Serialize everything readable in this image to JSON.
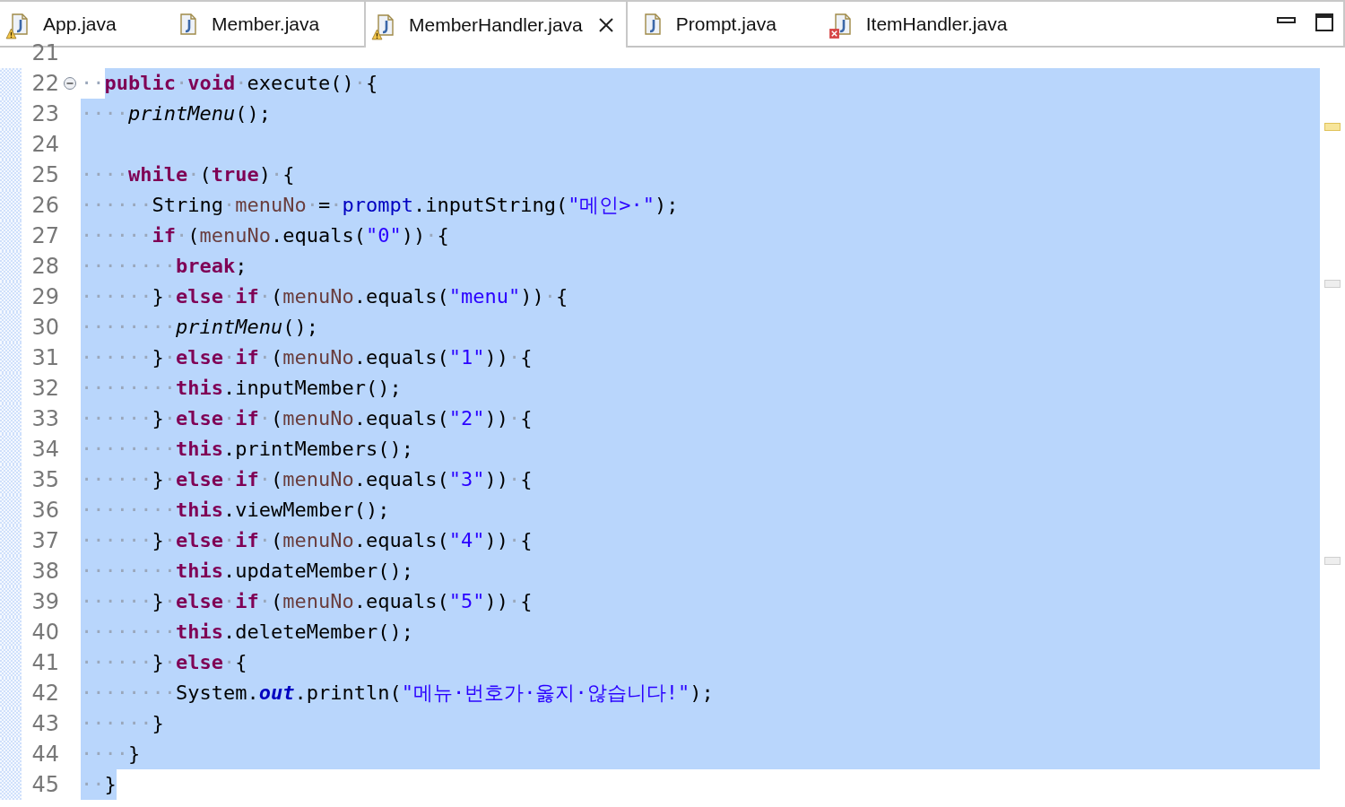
{
  "tabs": [
    {
      "label": "App.java",
      "selected": false,
      "warning": true
    },
    {
      "label": "Member.java",
      "selected": false
    },
    {
      "label": "MemberHandler.java",
      "selected": true,
      "warning": true
    },
    {
      "label": "Prompt.java",
      "selected": false
    },
    {
      "label": "ItemHandler.java",
      "selected": false,
      "error": true
    }
  ],
  "lines": [
    {
      "number": "21",
      "selected": false
    },
    {
      "number": "22",
      "expanded": true,
      "selected": true,
      "indent_unselected": true,
      "fill_to_edge": true,
      "tokens": [
        {
          "kind": "ws",
          "t": "··"
        },
        {
          "kind": "kw",
          "t": "public"
        },
        {
          "kind": "ws",
          "t": "·"
        },
        {
          "kind": "kw",
          "t": "void"
        },
        {
          "kind": "ws",
          "t": "·"
        },
        {
          "kind": "pl",
          "t": "execute()"
        },
        {
          "kind": "ws",
          "t": "·"
        },
        {
          "kind": "pl",
          "t": "{"
        }
      ]
    },
    {
      "number": "23",
      "selected": true,
      "fill_to_edge": true,
      "tokens": [
        {
          "kind": "ws",
          "t": "····"
        },
        {
          "kind": "it",
          "t": "printMenu"
        },
        {
          "kind": "pl",
          "t": "();"
        }
      ]
    },
    {
      "number": "24",
      "selected": true,
      "fill_to_edge": true
    },
    {
      "number": "25",
      "selected": true,
      "fill_to_edge": true,
      "tokens": [
        {
          "kind": "ws",
          "t": "····"
        },
        {
          "kind": "kw",
          "t": "while"
        },
        {
          "kind": "ws",
          "t": "·"
        },
        {
          "kind": "pl",
          "t": "("
        },
        {
          "kind": "kw",
          "t": "true"
        },
        {
          "kind": "pl",
          "t": ")"
        },
        {
          "kind": "ws",
          "t": "·"
        },
        {
          "kind": "pl",
          "t": "{"
        }
      ]
    },
    {
      "number": "26",
      "selected": true,
      "fill_to_edge": true,
      "tokens": [
        {
          "kind": "ws",
          "t": "······"
        },
        {
          "kind": "pl",
          "t": "String"
        },
        {
          "kind": "ws",
          "t": "·"
        },
        {
          "kind": "var",
          "t": "menuNo"
        },
        {
          "kind": "ws",
          "t": "·"
        },
        {
          "kind": "pl",
          "t": "="
        },
        {
          "kind": "ws",
          "t": "·"
        },
        {
          "kind": "fld",
          "t": "prompt"
        },
        {
          "kind": "pl",
          "t": ".inputString("
        },
        {
          "kind": "str",
          "t": "\"메인>·\""
        },
        {
          "kind": "pl",
          "t": ");"
        }
      ]
    },
    {
      "number": "27",
      "selected": true,
      "fill_to_edge": true,
      "tokens": [
        {
          "kind": "ws",
          "t": "······"
        },
        {
          "kind": "kw",
          "t": "if"
        },
        {
          "kind": "ws",
          "t": "·"
        },
        {
          "kind": "pl",
          "t": "("
        },
        {
          "kind": "var",
          "t": "menuNo"
        },
        {
          "kind": "pl",
          "t": ".equals("
        },
        {
          "kind": "str",
          "t": "\"0\""
        },
        {
          "kind": "pl",
          "t": "))"
        },
        {
          "kind": "ws",
          "t": "·"
        },
        {
          "kind": "pl",
          "t": "{"
        }
      ]
    },
    {
      "number": "28",
      "selected": true,
      "fill_to_edge": true,
      "tokens": [
        {
          "kind": "ws",
          "t": "········"
        },
        {
          "kind": "kw",
          "t": "break"
        },
        {
          "kind": "pl",
          "t": ";"
        }
      ]
    },
    {
      "number": "29",
      "selected": true,
      "fill_to_edge": true,
      "tokens": [
        {
          "kind": "ws",
          "t": "······"
        },
        {
          "kind": "pl",
          "t": "}"
        },
        {
          "kind": "ws",
          "t": "·"
        },
        {
          "kind": "kw",
          "t": "else"
        },
        {
          "kind": "ws",
          "t": "·"
        },
        {
          "kind": "kw",
          "t": "if"
        },
        {
          "kind": "ws",
          "t": "·"
        },
        {
          "kind": "pl",
          "t": "("
        },
        {
          "kind": "var",
          "t": "menuNo"
        },
        {
          "kind": "pl",
          "t": ".equals("
        },
        {
          "kind": "str",
          "t": "\"menu\""
        },
        {
          "kind": "pl",
          "t": "))"
        },
        {
          "kind": "ws",
          "t": "·"
        },
        {
          "kind": "pl",
          "t": "{"
        }
      ]
    },
    {
      "number": "30",
      "selected": true,
      "fill_to_edge": true,
      "tokens": [
        {
          "kind": "ws",
          "t": "········"
        },
        {
          "kind": "it",
          "t": "printMenu"
        },
        {
          "kind": "pl",
          "t": "();"
        }
      ]
    },
    {
      "number": "31",
      "selected": true,
      "fill_to_edge": true,
      "tokens": [
        {
          "kind": "ws",
          "t": "······"
        },
        {
          "kind": "pl",
          "t": "}"
        },
        {
          "kind": "ws",
          "t": "·"
        },
        {
          "kind": "kw",
          "t": "else"
        },
        {
          "kind": "ws",
          "t": "·"
        },
        {
          "kind": "kw",
          "t": "if"
        },
        {
          "kind": "ws",
          "t": "·"
        },
        {
          "kind": "pl",
          "t": "("
        },
        {
          "kind": "var",
          "t": "menuNo"
        },
        {
          "kind": "pl",
          "t": ".equals("
        },
        {
          "kind": "str",
          "t": "\"1\""
        },
        {
          "kind": "pl",
          "t": "))"
        },
        {
          "kind": "ws",
          "t": "·"
        },
        {
          "kind": "pl",
          "t": "{"
        }
      ]
    },
    {
      "number": "32",
      "selected": true,
      "fill_to_edge": true,
      "tokens": [
        {
          "kind": "ws",
          "t": "········"
        },
        {
          "kind": "kw",
          "t": "this"
        },
        {
          "kind": "pl",
          "t": ".inputMember();"
        }
      ]
    },
    {
      "number": "33",
      "selected": true,
      "fill_to_edge": true,
      "tokens": [
        {
          "kind": "ws",
          "t": "······"
        },
        {
          "kind": "pl",
          "t": "}"
        },
        {
          "kind": "ws",
          "t": "·"
        },
        {
          "kind": "kw",
          "t": "else"
        },
        {
          "kind": "ws",
          "t": "·"
        },
        {
          "kind": "kw",
          "t": "if"
        },
        {
          "kind": "ws",
          "t": "·"
        },
        {
          "kind": "pl",
          "t": "("
        },
        {
          "kind": "var",
          "t": "menuNo"
        },
        {
          "kind": "pl",
          "t": ".equals("
        },
        {
          "kind": "str",
          "t": "\"2\""
        },
        {
          "kind": "pl",
          "t": "))"
        },
        {
          "kind": "ws",
          "t": "·"
        },
        {
          "kind": "pl",
          "t": "{"
        }
      ]
    },
    {
      "number": "34",
      "selected": true,
      "fill_to_edge": true,
      "tokens": [
        {
          "kind": "ws",
          "t": "········"
        },
        {
          "kind": "kw",
          "t": "this"
        },
        {
          "kind": "pl",
          "t": ".printMembers();"
        }
      ]
    },
    {
      "number": "35",
      "selected": true,
      "fill_to_edge": true,
      "tokens": [
        {
          "kind": "ws",
          "t": "······"
        },
        {
          "kind": "pl",
          "t": "}"
        },
        {
          "kind": "ws",
          "t": "·"
        },
        {
          "kind": "kw",
          "t": "else"
        },
        {
          "kind": "ws",
          "t": "·"
        },
        {
          "kind": "kw",
          "t": "if"
        },
        {
          "kind": "ws",
          "t": "·"
        },
        {
          "kind": "pl",
          "t": "("
        },
        {
          "kind": "var",
          "t": "menuNo"
        },
        {
          "kind": "pl",
          "t": ".equals("
        },
        {
          "kind": "str",
          "t": "\"3\""
        },
        {
          "kind": "pl",
          "t": "))"
        },
        {
          "kind": "ws",
          "t": "·"
        },
        {
          "kind": "pl",
          "t": "{"
        }
      ]
    },
    {
      "number": "36",
      "selected": true,
      "fill_to_edge": true,
      "tokens": [
        {
          "kind": "ws",
          "t": "········"
        },
        {
          "kind": "kw",
          "t": "this"
        },
        {
          "kind": "pl",
          "t": ".viewMember();"
        }
      ]
    },
    {
      "number": "37",
      "selected": true,
      "fill_to_edge": true,
      "tokens": [
        {
          "kind": "ws",
          "t": "······"
        },
        {
          "kind": "pl",
          "t": "}"
        },
        {
          "kind": "ws",
          "t": "·"
        },
        {
          "kind": "kw",
          "t": "else"
        },
        {
          "kind": "ws",
          "t": "·"
        },
        {
          "kind": "kw",
          "t": "if"
        },
        {
          "kind": "ws",
          "t": "·"
        },
        {
          "kind": "pl",
          "t": "("
        },
        {
          "kind": "var",
          "t": "menuNo"
        },
        {
          "kind": "pl",
          "t": ".equals("
        },
        {
          "kind": "str",
          "t": "\"4\""
        },
        {
          "kind": "pl",
          "t": "))"
        },
        {
          "kind": "ws",
          "t": "·"
        },
        {
          "kind": "pl",
          "t": "{"
        }
      ]
    },
    {
      "number": "38",
      "selected": true,
      "fill_to_edge": true,
      "tokens": [
        {
          "kind": "ws",
          "t": "········"
        },
        {
          "kind": "kw",
          "t": "this"
        },
        {
          "kind": "pl",
          "t": ".updateMember();"
        }
      ]
    },
    {
      "number": "39",
      "selected": true,
      "fill_to_edge": true,
      "tokens": [
        {
          "kind": "ws",
          "t": "······"
        },
        {
          "kind": "pl",
          "t": "}"
        },
        {
          "kind": "ws",
          "t": "·"
        },
        {
          "kind": "kw",
          "t": "else"
        },
        {
          "kind": "ws",
          "t": "·"
        },
        {
          "kind": "kw",
          "t": "if"
        },
        {
          "kind": "ws",
          "t": "·"
        },
        {
          "kind": "pl",
          "t": "("
        },
        {
          "kind": "var",
          "t": "menuNo"
        },
        {
          "kind": "pl",
          "t": ".equals("
        },
        {
          "kind": "str",
          "t": "\"5\""
        },
        {
          "kind": "pl",
          "t": "))"
        },
        {
          "kind": "ws",
          "t": "·"
        },
        {
          "kind": "pl",
          "t": "{"
        }
      ]
    },
    {
      "number": "40",
      "selected": true,
      "fill_to_edge": true,
      "tokens": [
        {
          "kind": "ws",
          "t": "········"
        },
        {
          "kind": "kw",
          "t": "this"
        },
        {
          "kind": "pl",
          "t": ".deleteMember();"
        }
      ]
    },
    {
      "number": "41",
      "selected": true,
      "fill_to_edge": true,
      "tokens": [
        {
          "kind": "ws",
          "t": "······"
        },
        {
          "kind": "pl",
          "t": "}"
        },
        {
          "kind": "ws",
          "t": "·"
        },
        {
          "kind": "kw",
          "t": "else"
        },
        {
          "kind": "ws",
          "t": "·"
        },
        {
          "kind": "pl",
          "t": "{"
        }
      ]
    },
    {
      "number": "42",
      "selected": true,
      "fill_to_edge": true,
      "tokens": [
        {
          "kind": "ws",
          "t": "········"
        },
        {
          "kind": "pl",
          "t": "System."
        },
        {
          "kind": "sf",
          "t": "out"
        },
        {
          "kind": "pl",
          "t": ".println("
        },
        {
          "kind": "str",
          "t": "\"메뉴·번호가·옳지·않습니다!\""
        },
        {
          "kind": "pl",
          "t": ");"
        }
      ]
    },
    {
      "number": "43",
      "selected": true,
      "fill_to_edge": true,
      "tokens": [
        {
          "kind": "ws",
          "t": "······"
        },
        {
          "kind": "pl",
          "t": "}"
        }
      ]
    },
    {
      "number": "44",
      "selected": true,
      "fill_to_edge": true,
      "tokens": [
        {
          "kind": "ws",
          "t": "····"
        },
        {
          "kind": "pl",
          "t": "}"
        }
      ]
    },
    {
      "number": "45",
      "selected": true,
      "fill_to_edge": false,
      "tokens": [
        {
          "kind": "ws",
          "t": "··"
        },
        {
          "kind": "pl",
          "t": "}"
        }
      ]
    }
  ]
}
